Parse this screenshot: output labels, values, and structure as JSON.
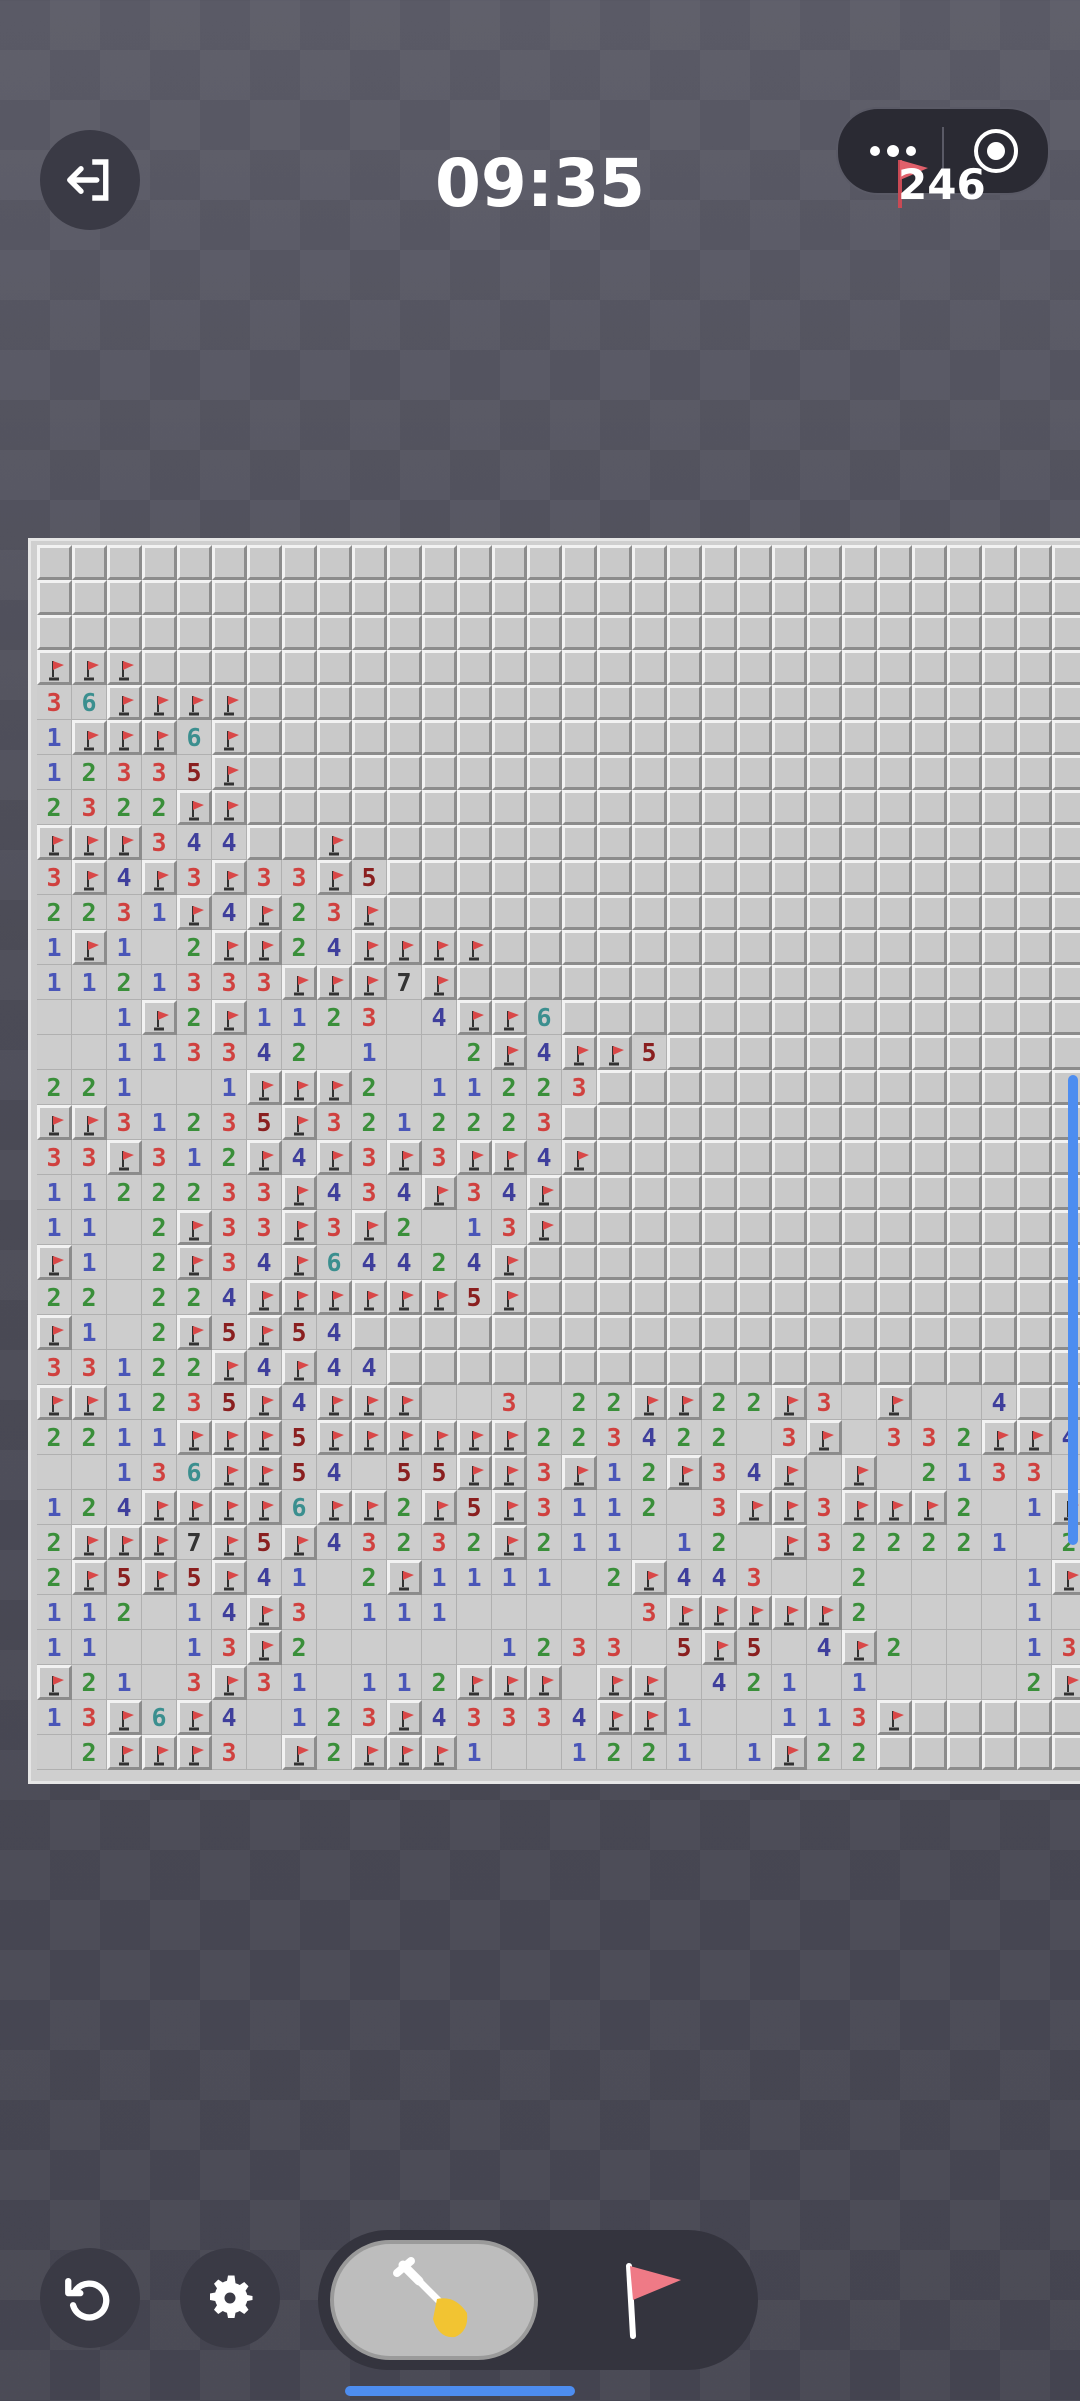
{
  "header": {
    "timer": "09:35",
    "flags_remaining": "246",
    "menu_icon": "more-dots-icon",
    "record_icon": "target-icon",
    "exit_icon": "exit-icon"
  },
  "board": {
    "rows_visible": 35,
    "cols_visible": 30,
    "rows": [
      "..............................",
      "..............................",
      "..............................",
      "FFF...........................",
      "36FFFF........................",
      "1FFF6F........................",
      "12335F........................",
      "2322FF........................",
      "FFF344..F.....................",
      "3F4F3F33F5....................",
      "2231F4F23F....................",
      "1F1 2FF24FFFF.................",
      "1121333FFF7F..................",
      "  1F2F1123 4FF6...............",
      "  113342 1  2F4FF5............",
      "221  1FFF2 11223..............",
      "FF31235F3212223...............",
      "33F312F4F3F3FF4F..............",
      "1122233F434F34F...............",
      "11 2F33F3F2 13F...............",
      "F1 2F34F64424F................",
      "22 224FFFFFF5F................",
      "F1 2F5F54.....................",
      "33122F4F44....................",
      "FF1235F4FFF  3 22FF22F3 F  4..",
      "2211FFF5FFFFFF223422 3F 332FF4F",
      "  136FF54 55FF3F12F34F F 2133 5F",
      "124FFFF6FF2F5F3112 3FF3FFF2 1F4F",
      "2FFF7F5F43232F211 12 F322221 2 3F4",
      "2F5F5F41 2F1111 2F443  2    1F13F",
      "112 14F3 111     3FFFFF2    1 333 3F",
      "11  13F2     1233 5F5 4F2   13FF  3",
      "F21 3F31 112FFF FF 421 1    2FF",
      "13F6F4 123F43334FF1  113F",
      " 2FFF3 F2FFF1  1221 1F22"
    ]
  },
  "toolbar": {
    "dig_icon": "shovel-icon",
    "flag_mode_icon": "flag-icon",
    "restart_icon": "restart-icon",
    "settings_icon": "gear-icon"
  },
  "colors": {
    "accent": "#4d8df0",
    "flag": "#e45757",
    "n1": "#4a56b8",
    "n2": "#3a8f3a",
    "n3": "#d0413f",
    "n4": "#3f3f9c",
    "n5": "#8a1f1f",
    "n6": "#3b8f8f"
  }
}
